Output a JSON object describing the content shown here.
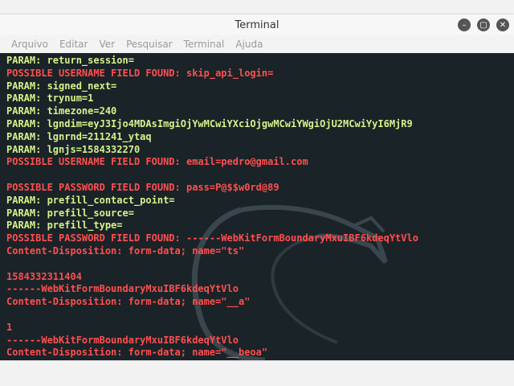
{
  "window": {
    "title": "Terminal",
    "controls": [
      "minimize-icon",
      "maximize-icon",
      "close-icon"
    ]
  },
  "menu": {
    "items": [
      "Arquivo",
      "Editar",
      "Ver",
      "Pesquisar",
      "Terminal",
      "Ajuda"
    ]
  },
  "colors": {
    "param": "#d7f28a",
    "found": "#ff4f4f",
    "background": "#1a2328"
  },
  "terminal": {
    "lines": [
      {
        "text": "PARAM: return_session=",
        "color": "param"
      },
      {
        "text": "POSSIBLE USERNAME FIELD FOUND: skip_api_login=",
        "color": "found"
      },
      {
        "text": "PARAM: signed_next=",
        "color": "param"
      },
      {
        "text": "PARAM: trynum=1",
        "color": "param"
      },
      {
        "text": "PARAM: timezone=240",
        "color": "param"
      },
      {
        "text": "PARAM: lgndim=eyJ3Ijo4MDAsImgiOjYwMCwiYXciOjgwMCwiYWgiOjU2MCwiYyI6MjR9",
        "color": "param"
      },
      {
        "text": "PARAM: lgnrnd=211241_ytaq",
        "color": "param"
      },
      {
        "text": "PARAM: lgnjs=1584332270",
        "color": "param"
      },
      {
        "text": "POSSIBLE USERNAME FIELD FOUND: email=pedro@gmail.com",
        "color": "found"
      },
      {
        "text": "",
        "color": "param"
      },
      {
        "text": "POSSIBLE PASSWORD FIELD FOUND: pass=P@$$w0rd@89",
        "color": "found"
      },
      {
        "text": "PARAM: prefill_contact_point=",
        "color": "param"
      },
      {
        "text": "PARAM: prefill_source=",
        "color": "param"
      },
      {
        "text": "PARAM: prefill_type=",
        "color": "param"
      },
      {
        "text": "POSSIBLE PASSWORD FIELD FOUND: ------WebKitFormBoundaryMxuIBF6kdeqYtVlo",
        "color": "found"
      },
      {
        "text": "Content-Disposition: form-data; name=\"ts\"",
        "color": "found"
      },
      {
        "text": "",
        "color": "found"
      },
      {
        "text": "1584332311404",
        "color": "found"
      },
      {
        "text": "------WebKitFormBoundaryMxuIBF6kdeqYtVlo",
        "color": "found"
      },
      {
        "text": "Content-Disposition: form-data; name=\"__a\"",
        "color": "found"
      },
      {
        "text": "",
        "color": "found"
      },
      {
        "text": "1",
        "color": "found"
      },
      {
        "text": "------WebKitFormBoundaryMxuIBF6kdeqYtVlo",
        "color": "found"
      },
      {
        "text": "Content-Disposition: form-data; name=\"__beoa\"",
        "color": "found"
      }
    ]
  }
}
